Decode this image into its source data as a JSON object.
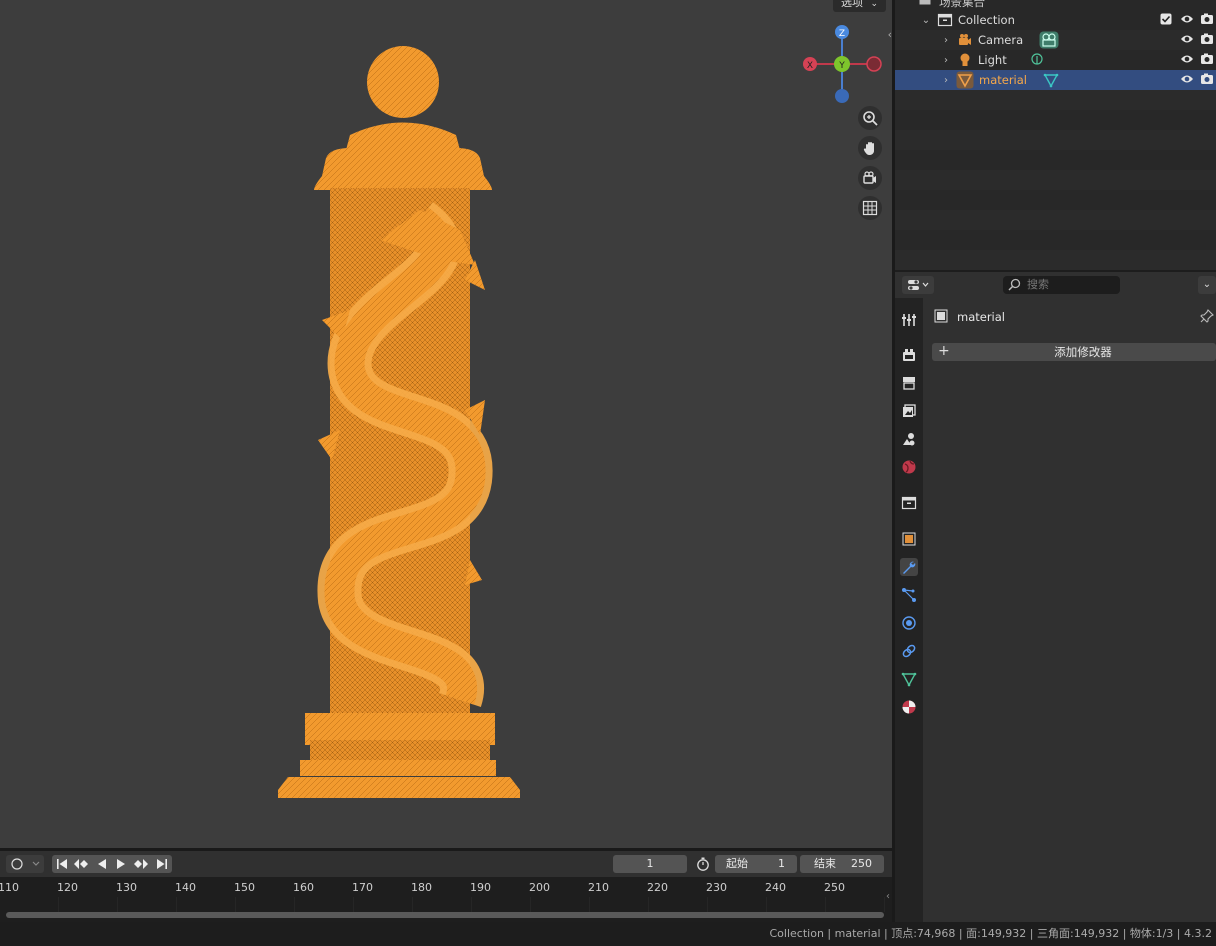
{
  "viewport": {
    "options_label": "选项",
    "gizmo": {
      "z": "Z",
      "y": "Y",
      "x": "X"
    },
    "nav_icons": [
      "zoom-icon",
      "hand-pan-icon",
      "camera-view-icon",
      "grid-ortho-icon"
    ],
    "object_color": "#f5a623"
  },
  "outliner": {
    "scene_label": "场景集合",
    "rows": [
      {
        "label": "Collection",
        "icon": "collection-icon"
      },
      {
        "label": "Camera",
        "icon": "camera-object-icon"
      },
      {
        "label": "Light",
        "icon": "light-object-icon"
      },
      {
        "label": "material",
        "icon": "mesh-object-icon"
      }
    ],
    "selected_color": "#334d80"
  },
  "properties": {
    "search_placeholder": "搜索",
    "object_name": "material",
    "add_modifier_label": "添加修改器",
    "tabs": [
      "tool-icon",
      "render-icon",
      "output-icon",
      "view-layer-icon",
      "scene-icon",
      "world-icon",
      "collection-icon",
      "object-icon",
      "modifier-icon",
      "particles-icon",
      "physics-icon",
      "constraints-icon",
      "data-icon",
      "material-icon"
    ],
    "active_tab": "modifier-icon"
  },
  "timeline": {
    "current_frame": "1",
    "start_label": "起始",
    "start_value": "1",
    "end_label": "结束",
    "end_value": "250",
    "ticks": [
      "110",
      "120",
      "130",
      "140",
      "150",
      "160",
      "170",
      "180",
      "190",
      "200",
      "210",
      "220",
      "230",
      "240",
      "250"
    ]
  },
  "statusbar": {
    "text": "Collection | material | 顶点:74,968 | 面:149,932 | 三角面:149,932 | 物体:1/3 | 4.3.2"
  }
}
